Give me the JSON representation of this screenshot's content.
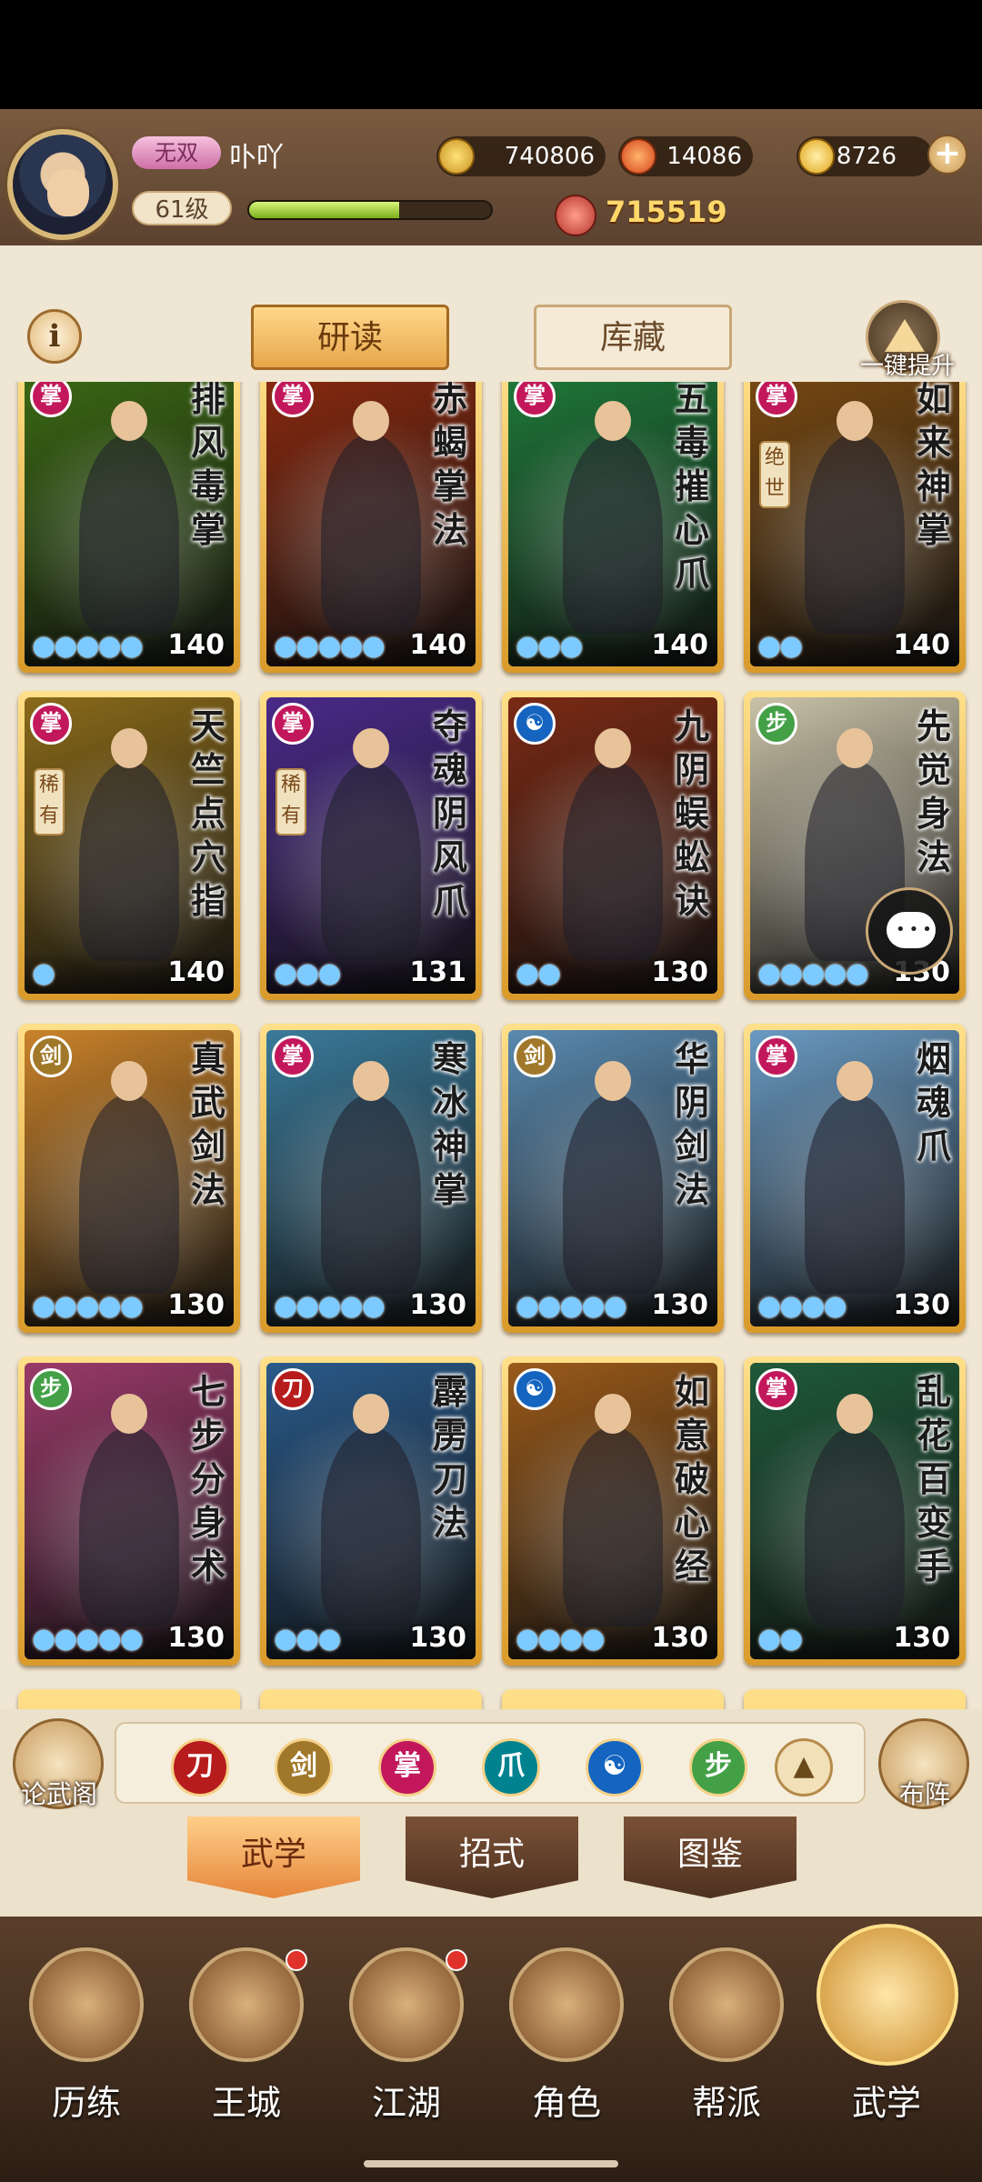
{
  "header": {
    "title_badge": "无双",
    "player_name": "卟吖",
    "level": "61级",
    "exp_fraction": 0.62,
    "coins": "740806",
    "flame": "14086",
    "ingots": "8726",
    "power": "715519"
  },
  "toolbar": {
    "info_label": "i",
    "tab_study": "研读",
    "tab_collection": "库藏",
    "upgrade_all": "一键提升"
  },
  "cards": [
    {
      "name": "排风毒掌",
      "level": "140",
      "pips": 5,
      "school": "palm",
      "color": "#c2185b",
      "rarity": "",
      "bg": "#3c6a14"
    },
    {
      "name": "赤蝎掌法",
      "level": "140",
      "pips": 5,
      "school": "palm",
      "color": "#c2185b",
      "rarity": "",
      "bg": "#8a2a10"
    },
    {
      "name": "五毒摧心爪",
      "level": "140",
      "pips": 3,
      "school": "palm",
      "color": "#c2185b",
      "rarity": "",
      "bg": "#1f7a3a"
    },
    {
      "name": "如来神掌",
      "level": "140",
      "pips": 2,
      "school": "palm",
      "color": "#c2185b",
      "rarity": "绝世",
      "bg": "#7a4a12"
    },
    {
      "name": "天竺点穴指",
      "level": "140",
      "pips": 1,
      "school": "palm",
      "color": "#c2185b",
      "rarity": "稀有",
      "bg": "#8a6a1a"
    },
    {
      "name": "夺魂阴风爪",
      "level": "131",
      "pips": 3,
      "school": "palm",
      "color": "#c2185b",
      "rarity": "稀有",
      "bg": "#4a2a8a"
    },
    {
      "name": "九阴蜈蚣诀",
      "level": "130",
      "pips": 2,
      "school": "yin",
      "color": "#1565c0",
      "rarity": "",
      "bg": "#7a2a14"
    },
    {
      "name": "先觉身法",
      "level": "130",
      "pips": 5,
      "school": "step",
      "color": "#43a047",
      "rarity": "",
      "bg": "#c9c2a8"
    },
    {
      "name": "真武剑法",
      "level": "130",
      "pips": 5,
      "school": "sword",
      "color": "#a1782a",
      "rarity": "",
      "bg": "#c9822a"
    },
    {
      "name": "寒冰神掌",
      "level": "130",
      "pips": 5,
      "school": "palm",
      "color": "#c2185b",
      "rarity": "",
      "bg": "#3a7a9a"
    },
    {
      "name": "华阴剑法",
      "level": "130",
      "pips": 5,
      "school": "sword",
      "color": "#a1782a",
      "rarity": "",
      "bg": "#5a8ab0"
    },
    {
      "name": "烟魂爪",
      "level": "130",
      "pips": 4,
      "school": "palm",
      "color": "#c2185b",
      "rarity": "",
      "bg": "#6a9ac2"
    },
    {
      "name": "七步分身术",
      "level": "130",
      "pips": 5,
      "school": "step",
      "color": "#43a047",
      "rarity": "",
      "bg": "#9a3a6a"
    },
    {
      "name": "霹雳刀法",
      "level": "130",
      "pips": 3,
      "school": "blade",
      "color": "#b71c1c",
      "rarity": "",
      "bg": "#2a5a8a"
    },
    {
      "name": "如意破心经",
      "level": "130",
      "pips": 4,
      "school": "yin",
      "color": "#1565c0",
      "rarity": "",
      "bg": "#9a5a1a"
    },
    {
      "name": "乱花百变手",
      "level": "130",
      "pips": 2,
      "school": "palm",
      "color": "#c2185b",
      "rarity": "",
      "bg": "#1f5a3a"
    }
  ],
  "filters": {
    "left_label": "论武阁",
    "right_label": "布阵",
    "icons": [
      {
        "name": "blade-school-filter",
        "color": "#b71c1c",
        "glyph": "刀"
      },
      {
        "name": "sword-school-filter",
        "color": "#a1782a",
        "glyph": "剑"
      },
      {
        "name": "palm-school-filter",
        "color": "#c2185b",
        "glyph": "掌"
      },
      {
        "name": "claw-school-filter",
        "color": "#00838f",
        "glyph": "爪"
      },
      {
        "name": "yin-school-filter",
        "color": "#1565c0",
        "glyph": "☯"
      },
      {
        "name": "step-school-filter",
        "color": "#43a047",
        "glyph": "步"
      }
    ]
  },
  "subtabs": {
    "martial": "武学",
    "moves": "招式",
    "atlas": "图鉴"
  },
  "nav": [
    {
      "name": "nav-trials",
      "label": "历练",
      "dot": false,
      "active": false
    },
    {
      "name": "nav-city",
      "label": "王城",
      "dot": true,
      "active": false
    },
    {
      "name": "nav-jianghu",
      "label": "江湖",
      "dot": true,
      "active": false
    },
    {
      "name": "nav-character",
      "label": "角色",
      "dot": false,
      "active": false
    },
    {
      "name": "nav-guild",
      "label": "帮派",
      "dot": false,
      "active": false
    },
    {
      "name": "nav-martial",
      "label": "武学",
      "dot": false,
      "active": true
    }
  ]
}
